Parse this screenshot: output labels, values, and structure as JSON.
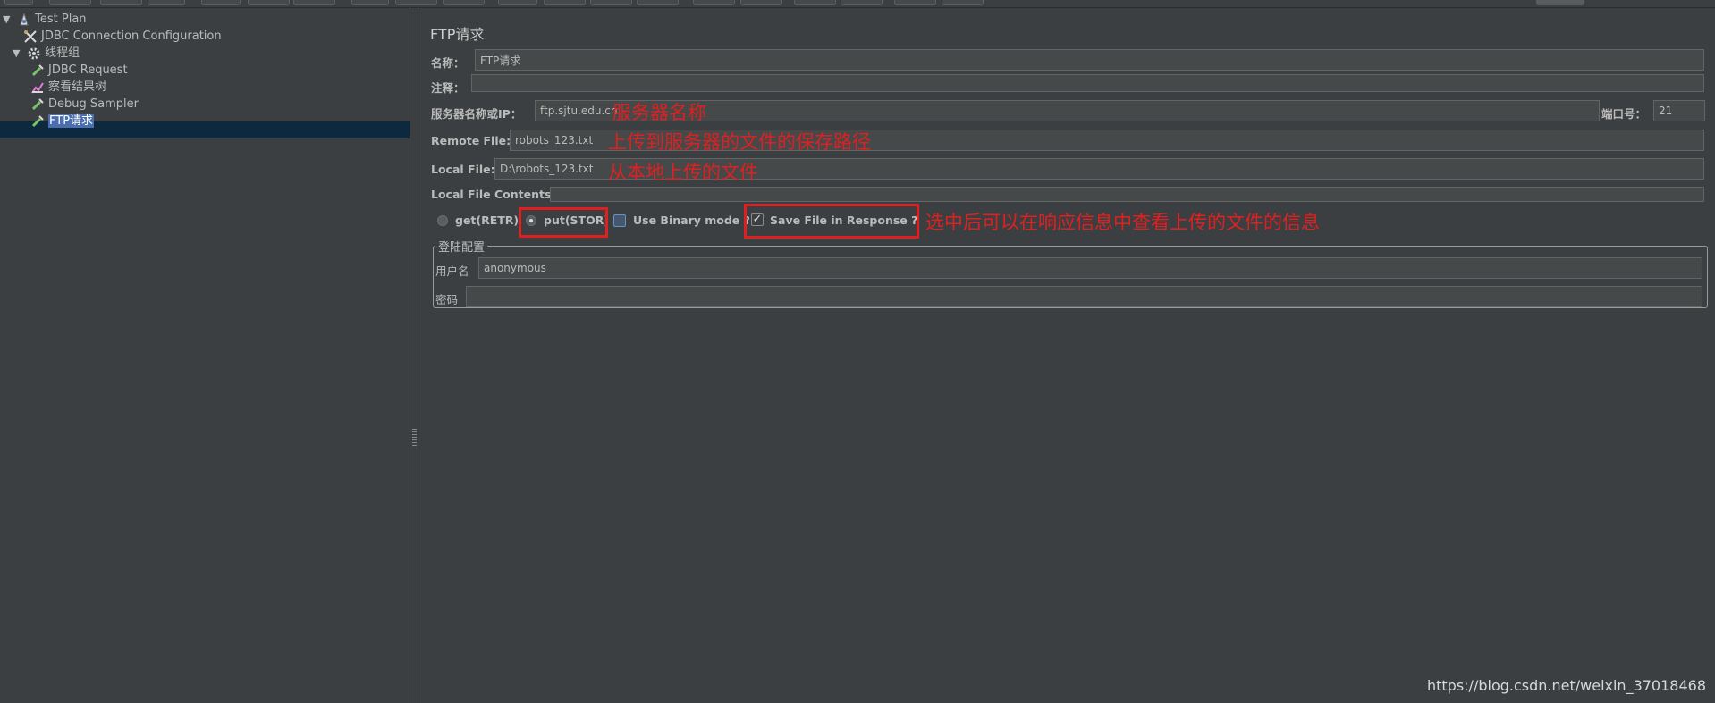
{
  "tree": {
    "items": [
      {
        "label": "Test Plan",
        "icon": "test-plan-icon",
        "expanded": true
      },
      {
        "label": "JDBC Connection Configuration",
        "icon": "config-wrench-icon"
      },
      {
        "label": "线程组",
        "icon": "thread-group-gear-icon",
        "expanded": true
      },
      {
        "label": "JDBC Request",
        "icon": "sampler-pipette-icon"
      },
      {
        "label": "察看结果树",
        "icon": "listener-chart-icon"
      },
      {
        "label": "Debug Sampler",
        "icon": "sampler-pipette-icon"
      },
      {
        "label": "FTP请求",
        "icon": "sampler-pipette-icon",
        "selected": true
      }
    ]
  },
  "form": {
    "title": "FTP请求",
    "name_label": "名称：",
    "name_value": "FTP请求",
    "comment_label": "注释：",
    "comment_value": "",
    "server_label": "服务器名称或IP：",
    "server_value": "ftp.sjtu.edu.cn",
    "port_label": "端口号：",
    "port_value": "21",
    "remote_label": "Remote File:",
    "remote_value": "robots_123.txt",
    "local_label": "Local File:",
    "local_value": "D:\\robots_123.txt",
    "contents_label": "Local File Contents:",
    "get_label": "get(RETR)",
    "put_label": "put(STOR)",
    "binary_label": "Use Binary mode ?",
    "save_label": "Save File in Response ?",
    "login_group_label": "登陆配置",
    "username_label": "用户名",
    "username_value": "anonymous",
    "password_label": "密码",
    "password_value": "",
    "selected_method": "put(STOR)",
    "binary_checked": false,
    "save_checked": true
  },
  "annotations": {
    "server": "服务器名称",
    "remote": "上传到服务器的文件的保存路径",
    "local": "从本地上传的文件",
    "save": "选中后可以在响应信息中查看上传的文件的信息"
  },
  "watermark": "https://blog.csdn.net/weixin_37018468",
  "colors": {
    "background": "#3c3f41",
    "selection": "#4b6eaf",
    "annotation": "#e02020"
  }
}
